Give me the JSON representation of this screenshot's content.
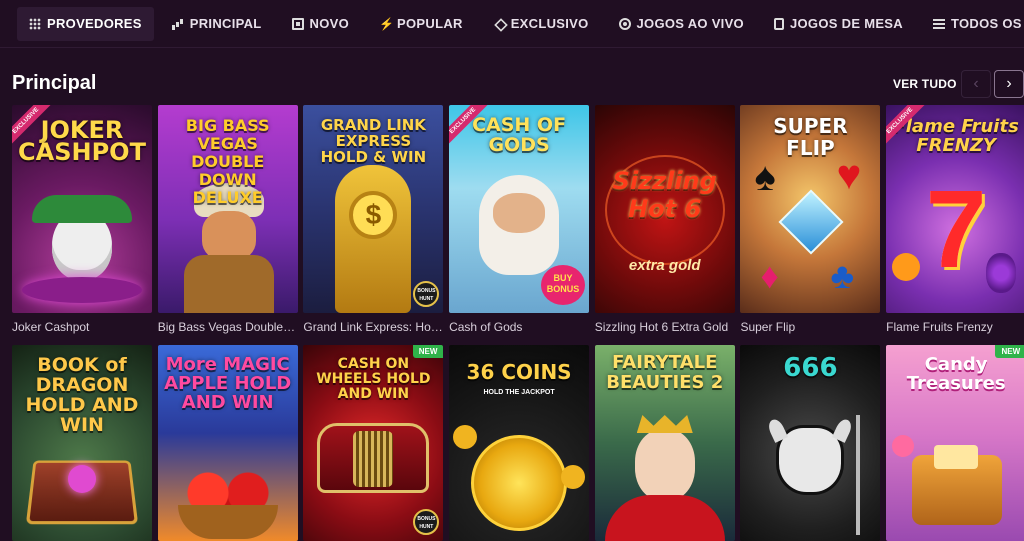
{
  "nav": [
    {
      "label": "PROVEDORES",
      "icon": "grid-icon",
      "active": true
    },
    {
      "label": "PRINCIPAL",
      "icon": "bar-chart-icon"
    },
    {
      "label": "NOVO",
      "icon": "new-square-icon"
    },
    {
      "label": "POPULAR",
      "icon": "bolt-icon"
    },
    {
      "label": "EXCLUSIVO",
      "icon": "diamond-icon"
    },
    {
      "label": "JOGOS AO VIVO",
      "icon": "chip-icon"
    },
    {
      "label": "JOGOS DE MESA",
      "icon": "card-icon"
    },
    {
      "label": "TODOS OS JOGOS",
      "icon": "list-icon"
    }
  ],
  "section": {
    "title": "Principal",
    "see_all": "VER TUDO",
    "prev": "‹",
    "next": "›"
  },
  "row1": [
    {
      "title": "Joker Cashpot",
      "art": "JOKER CASHPOT",
      "badge": "EXCLUSIVE"
    },
    {
      "title": "Big Bass Vegas Double Down Deluxe",
      "art": "BIG BASS VEGAS DOUBLE DOWN DELUXE"
    },
    {
      "title": "Grand Link Express: Hold & Win",
      "art": "GRAND LINK EXPRESS HOLD & WIN",
      "hunt": "BONUS HUNT"
    },
    {
      "title": "Cash of Gods",
      "art": "CASH OF GODS",
      "badge": "EXCLUSIVE",
      "sticker": "BUY BONUS"
    },
    {
      "title": "Sizzling Hot 6 Extra Gold",
      "art": "Sizzling Hot 6",
      "sub": "extra gold"
    },
    {
      "title": "Super Flip",
      "art": "SUPER FLIP"
    },
    {
      "title": "Flame Fruits Frenzy",
      "art": "Flame Fruits FRENZY",
      "badge": "EXCLUSIVE"
    }
  ],
  "row2": [
    {
      "art": "BOOK of DRAGON HOLD AND WIN"
    },
    {
      "art": "More MAGIC APPLE HOLD AND WIN"
    },
    {
      "art": "CASH ON WHEELS HOLD AND WIN",
      "badge": "NEW",
      "hunt": "BONUS HUNT"
    },
    {
      "art": "36 COINS",
      "sub": "HOLD THE JACKPOT"
    },
    {
      "art": "FAIRYTALE BEAUTIES 2"
    },
    {
      "art": "666"
    },
    {
      "art": "Candy Treasures",
      "badge": "NEW"
    }
  ],
  "colors": {
    "bg": "#200e22",
    "accent": "#d52a6e",
    "new": "#2fb34a"
  }
}
